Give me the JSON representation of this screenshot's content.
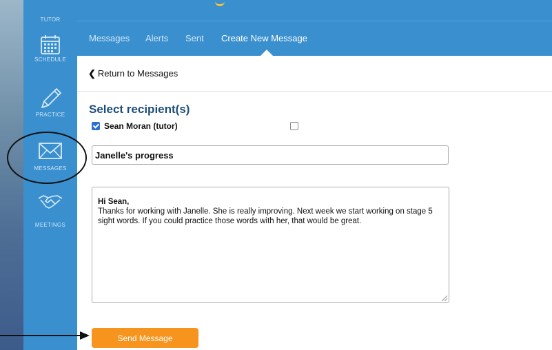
{
  "sidebar": {
    "items": [
      {
        "label": "TUTOR",
        "icon": "tutor-icon"
      },
      {
        "label": "SCHEDULE",
        "icon": "calendar-icon"
      },
      {
        "label": "PRACTICE",
        "icon": "pencil-icon"
      },
      {
        "label": "MESSAGES",
        "icon": "envelope-icon"
      },
      {
        "label": "MEETINGS",
        "icon": "handshake-icon"
      }
    ]
  },
  "nav": {
    "tabs": [
      {
        "label": "Messages"
      },
      {
        "label": "Alerts"
      },
      {
        "label": "Sent"
      },
      {
        "label": "Create New Message",
        "active": true
      }
    ]
  },
  "back_link": {
    "icon": "chevron-left-icon",
    "label": "Return to Messages"
  },
  "compose": {
    "heading": "Select recipient(s)",
    "recipients": [
      {
        "label": "Sean Moran (tutor)",
        "checked": true
      },
      {
        "label": "",
        "checked": false
      }
    ],
    "subject": "Janelle's progress",
    "body_greeting": "Hi Sean,",
    "body_text": "Thanks for working with Janelle. She  is really improving. Next week we start working on stage 5 sight words. If you could practice those words with her, that would be great.",
    "send_label": "Send Message"
  },
  "colors": {
    "sidebar": "#3a8fcf",
    "heading": "#1d4e7a",
    "button": "#f7941d",
    "accent_logo": "#f5c33b"
  }
}
